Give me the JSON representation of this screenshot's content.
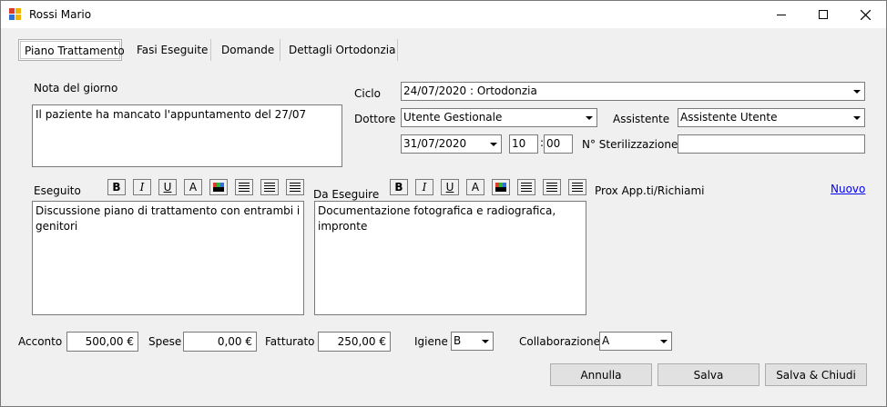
{
  "window": {
    "title": "Rossi Mario",
    "minimize_icon": "minimize-icon",
    "maximize_icon": "maximize-icon",
    "close_icon": "close-icon"
  },
  "tabs": [
    {
      "label": "Piano Trattamento",
      "active": true
    },
    {
      "label": "Fasi Eseguite",
      "active": false
    },
    {
      "label": "Domande",
      "active": false
    },
    {
      "label": "Dettagli Ortodonzia",
      "active": false
    }
  ],
  "nota": {
    "label": "Nota del giorno",
    "value": "Il paziente ha mancato l'appuntamento del 27/07"
  },
  "ciclo": {
    "label": "Ciclo",
    "value": "24/07/2020 : Ortodonzia"
  },
  "dottore": {
    "label": "Dottore",
    "value": "Utente Gestionale"
  },
  "assistente": {
    "label": "Assistente",
    "value": "Assistente Utente"
  },
  "data": {
    "date": "31/07/2020",
    "hour": "10",
    "separator": ":",
    "minute": "00"
  },
  "sterilizzazione": {
    "label": "N° Sterilizzazione",
    "value": ""
  },
  "eseguito": {
    "label": "Eseguito",
    "value": "Discussione piano di trattamento con entrambi i genitori"
  },
  "da_eseguire": {
    "label": "Da Eseguire",
    "value": "Documentazione fotografica e radiografica, impronte"
  },
  "format_toolbar": {
    "bold": "B",
    "italic": "I",
    "underline": "U",
    "font": "A"
  },
  "prox": {
    "label": "Prox App.ti/Richiami",
    "new_link": "Nuovo"
  },
  "footer": {
    "acconto_label": "Acconto",
    "acconto_value": "500,00 €",
    "spese_label": "Spese",
    "spese_value": "0,00 €",
    "fatturato_label": "Fatturato",
    "fatturato_value": "250,00 €",
    "igiene_label": "Igiene",
    "igiene_value": "B",
    "collaborazione_label": "Collaborazione",
    "collaborazione_value": "A"
  },
  "buttons": {
    "annulla": "Annulla",
    "salva": "Salva",
    "salva_chiudi": "Salva & Chiudi"
  }
}
